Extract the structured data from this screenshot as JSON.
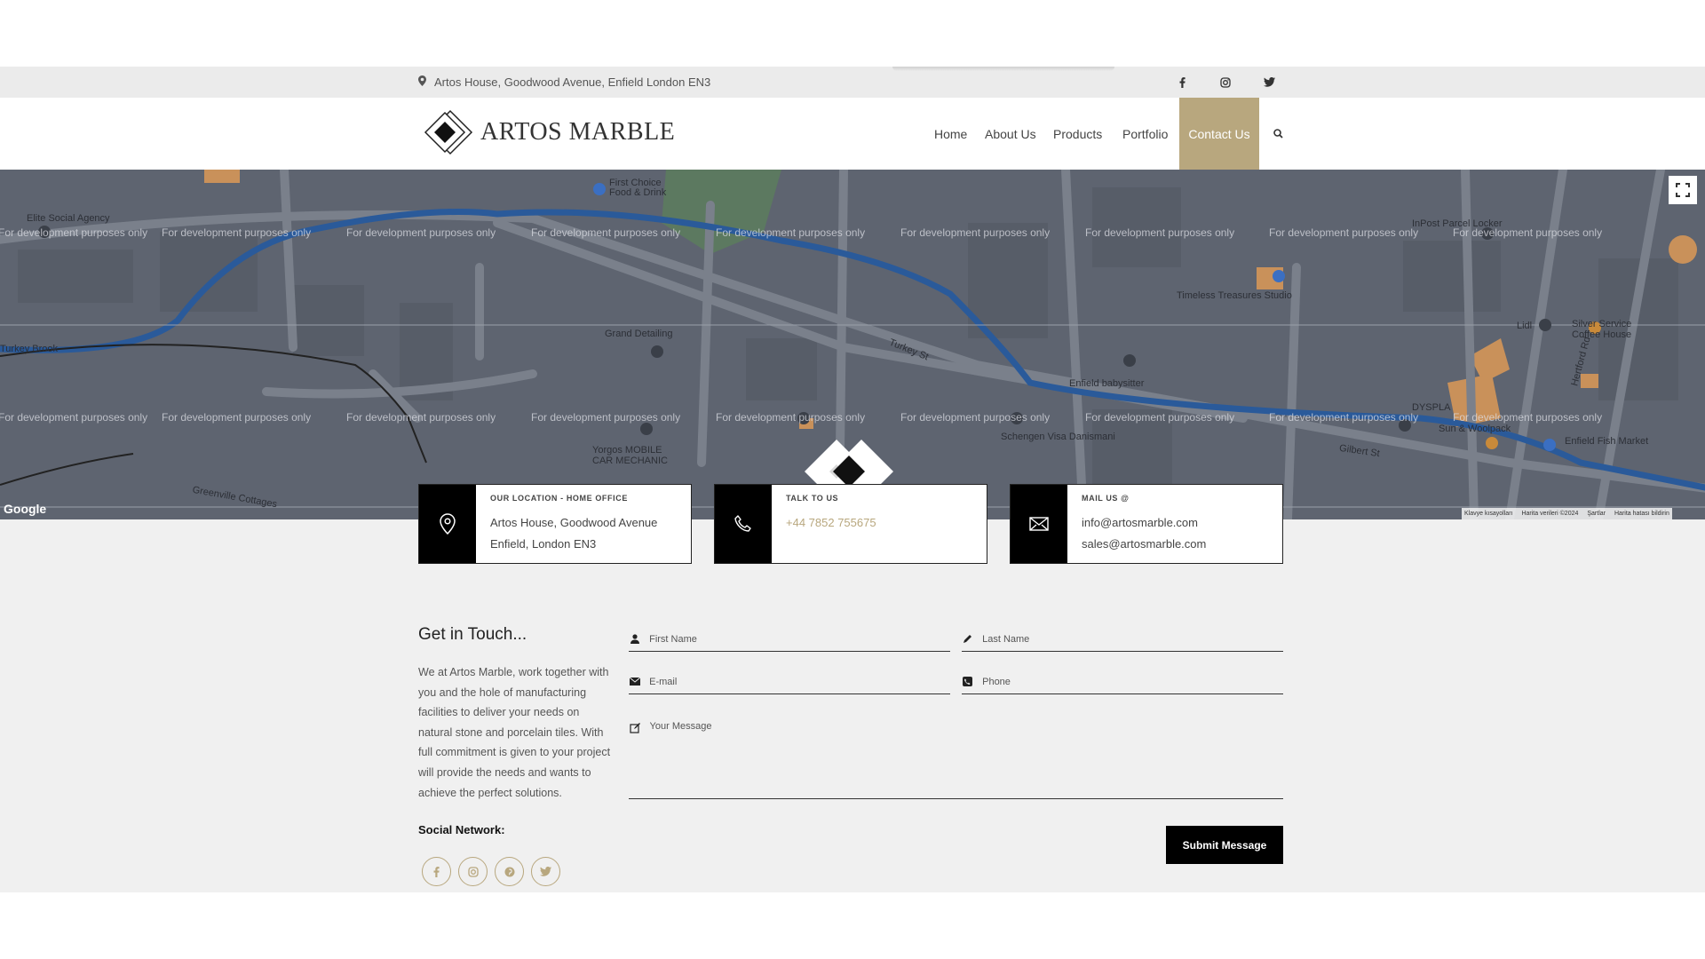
{
  "topbar": {
    "address": "Artos House, Goodwood Avenue, Enfield London EN3",
    "social_icons": [
      "facebook-icon",
      "instagram-icon",
      "twitter-icon"
    ]
  },
  "header": {
    "brand": "ARTOS MARBLE",
    "nav": [
      "Home",
      "About Us",
      "Products",
      "Portfolio",
      "Contact Us"
    ],
    "active_nav": "Contact Us",
    "accent_color": "#b8a77e"
  },
  "map": {
    "watermark": "For development purposes only",
    "labels": {
      "elite": "Elite Social Agency",
      "first_choice": "First Choice",
      "first_choice_sub": "Food & Drink",
      "inpost": "InPost Parcel Locker",
      "timeless": "Timeless Treasures Studio",
      "grand": "Grand Detailing",
      "enfield_baby": "Enfield babysitter",
      "lidl": "Lidl",
      "silver": "Silver Service",
      "silver_sub": "Coffee House",
      "turkey_brook": "Turkey Brook",
      "turkey_st": "Turkey St",
      "schengen": "Schengen Visa Danismani",
      "yorgos": "Yorgos MOBILE",
      "yorgos_sub": "CAR MECHANIC",
      "sun": "Sun & Woolpack",
      "fish": "Enfield Fish Market",
      "gilbert": "Gilbert St",
      "dyspla": "DYSPLA",
      "hertford": "Hertford Rd",
      "greenville": "Greenville Cottages"
    },
    "google": "Google",
    "attribution": [
      "Klavye kısayolları",
      "Harita verileri ©2024",
      "Şartlar",
      "Harita hatası bildirin"
    ]
  },
  "cards": [
    {
      "title": "OUR LOCATION - HOME OFFICE",
      "line1": "Artos House, Goodwood Avenue",
      "line2": "Enfield, London EN3"
    },
    {
      "title": "TALK TO US",
      "line1": "+44 7852 755675",
      "line2": ""
    },
    {
      "title": "MAIL US @",
      "line1": "info@artosmarble.com",
      "line2": "sales@artosmarble.com"
    }
  ],
  "contact": {
    "title": "Get in Touch...",
    "text": "We at Artos Marble, work together with you and the hole of manufacturing facilities to deliver your needs on natural stone and porcelain tiles. With full commitment is given to your project will provide the needs and wants to achieve the perfect solutions.",
    "social_title": "Social Network:",
    "social_icons": [
      "facebook-icon",
      "instagram-icon",
      "pinterest-icon",
      "twitter-icon"
    ]
  },
  "form": {
    "first_name": "First Name",
    "last_name": "Last Name",
    "email": "E-mail",
    "phone": "Phone",
    "message": "Your Message",
    "submit": "Submit Message"
  }
}
